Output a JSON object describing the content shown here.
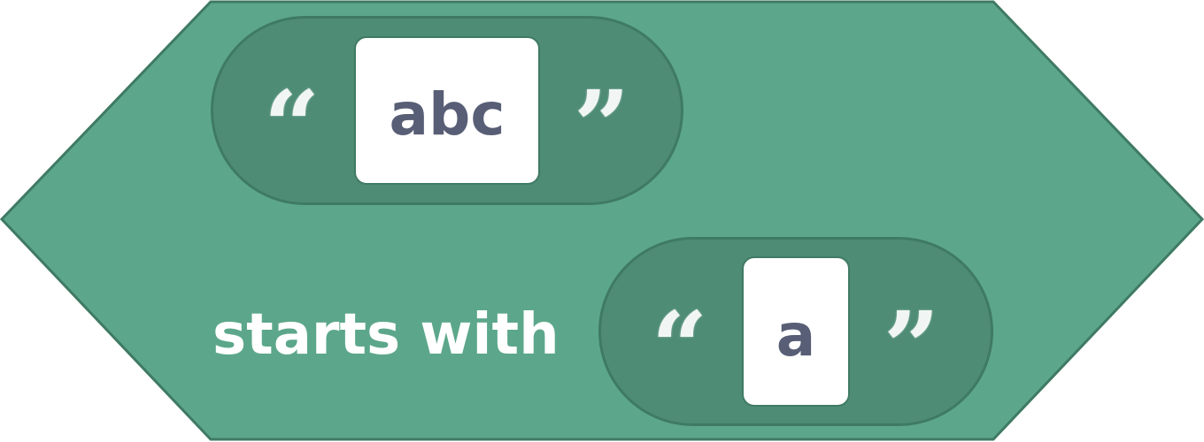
{
  "block": {
    "category": "operators",
    "fill_color": "#5ca78b",
    "stroke_color": "#3f7a64",
    "input_pill_color": "#4e8c76",
    "text_color": "#575e75",
    "label": "starts with",
    "first_input": {
      "open_quote": "“",
      "value": "abc",
      "close_quote": "”"
    },
    "second_input": {
      "open_quote": "“",
      "value": "a",
      "close_quote": "”"
    }
  }
}
